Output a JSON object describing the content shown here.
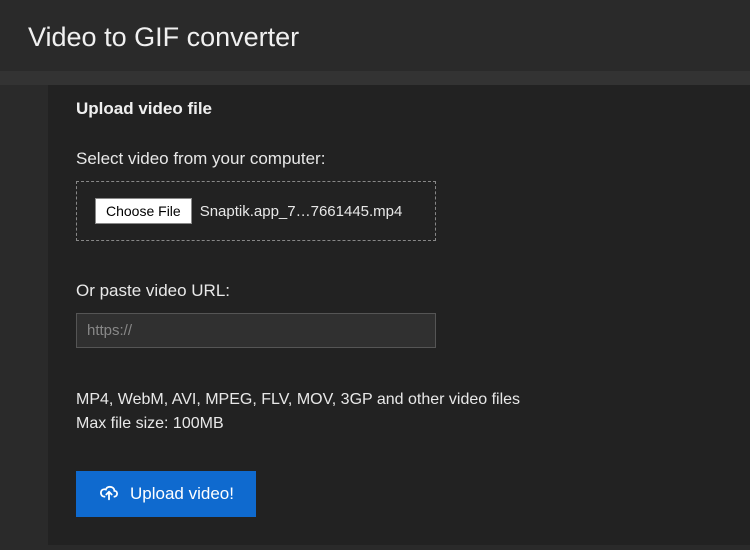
{
  "page": {
    "title": "Video to GIF converter"
  },
  "upload": {
    "section_title": "Upload video file",
    "select_label": "Select video from your computer:",
    "choose_file_btn": "Choose File",
    "file_name": "Snaptik.app_7…7661445.mp4",
    "url_label": "Or paste video URL:",
    "url_placeholder": "https://",
    "info_line1": "MP4, WebM, AVI, MPEG, FLV, MOV, 3GP and other video files",
    "info_line2": "Max file size: 100MB",
    "upload_btn": "Upload video!"
  }
}
